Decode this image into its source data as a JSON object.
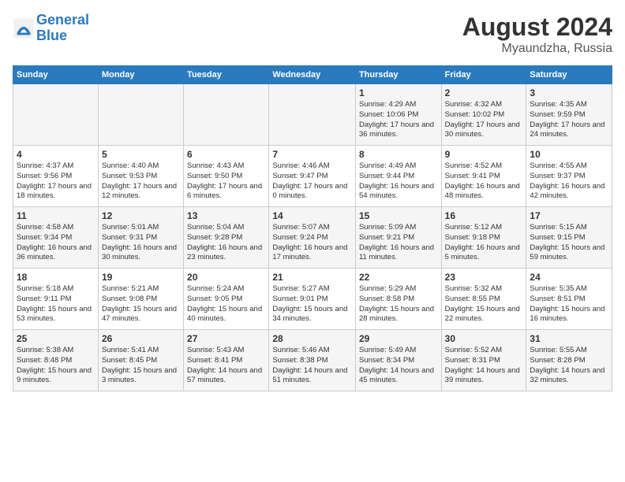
{
  "header": {
    "logo_line1": "General",
    "logo_line2": "Blue",
    "month": "August 2024",
    "location": "Myaundzha, Russia"
  },
  "days_of_week": [
    "Sunday",
    "Monday",
    "Tuesday",
    "Wednesday",
    "Thursday",
    "Friday",
    "Saturday"
  ],
  "weeks": [
    [
      {
        "num": "",
        "info": ""
      },
      {
        "num": "",
        "info": ""
      },
      {
        "num": "",
        "info": ""
      },
      {
        "num": "",
        "info": ""
      },
      {
        "num": "1",
        "info": "Sunrise: 4:29 AM\nSunset: 10:06 PM\nDaylight: 17 hours\nand 36 minutes."
      },
      {
        "num": "2",
        "info": "Sunrise: 4:32 AM\nSunset: 10:02 PM\nDaylight: 17 hours\nand 30 minutes."
      },
      {
        "num": "3",
        "info": "Sunrise: 4:35 AM\nSunset: 9:59 PM\nDaylight: 17 hours\nand 24 minutes."
      }
    ],
    [
      {
        "num": "4",
        "info": "Sunrise: 4:37 AM\nSunset: 9:56 PM\nDaylight: 17 hours\nand 18 minutes."
      },
      {
        "num": "5",
        "info": "Sunrise: 4:40 AM\nSunset: 9:53 PM\nDaylight: 17 hours\nand 12 minutes."
      },
      {
        "num": "6",
        "info": "Sunrise: 4:43 AM\nSunset: 9:50 PM\nDaylight: 17 hours\nand 6 minutes."
      },
      {
        "num": "7",
        "info": "Sunrise: 4:46 AM\nSunset: 9:47 PM\nDaylight: 17 hours\nand 0 minutes."
      },
      {
        "num": "8",
        "info": "Sunrise: 4:49 AM\nSunset: 9:44 PM\nDaylight: 16 hours\nand 54 minutes."
      },
      {
        "num": "9",
        "info": "Sunrise: 4:52 AM\nSunset: 9:41 PM\nDaylight: 16 hours\nand 48 minutes."
      },
      {
        "num": "10",
        "info": "Sunrise: 4:55 AM\nSunset: 9:37 PM\nDaylight: 16 hours\nand 42 minutes."
      }
    ],
    [
      {
        "num": "11",
        "info": "Sunrise: 4:58 AM\nSunset: 9:34 PM\nDaylight: 16 hours\nand 36 minutes."
      },
      {
        "num": "12",
        "info": "Sunrise: 5:01 AM\nSunset: 9:31 PM\nDaylight: 16 hours\nand 30 minutes."
      },
      {
        "num": "13",
        "info": "Sunrise: 5:04 AM\nSunset: 9:28 PM\nDaylight: 16 hours\nand 23 minutes."
      },
      {
        "num": "14",
        "info": "Sunrise: 5:07 AM\nSunset: 9:24 PM\nDaylight: 16 hours\nand 17 minutes."
      },
      {
        "num": "15",
        "info": "Sunrise: 5:09 AM\nSunset: 9:21 PM\nDaylight: 16 hours\nand 11 minutes."
      },
      {
        "num": "16",
        "info": "Sunrise: 5:12 AM\nSunset: 9:18 PM\nDaylight: 16 hours\nand 5 minutes."
      },
      {
        "num": "17",
        "info": "Sunrise: 5:15 AM\nSunset: 9:15 PM\nDaylight: 15 hours\nand 59 minutes."
      }
    ],
    [
      {
        "num": "18",
        "info": "Sunrise: 5:18 AM\nSunset: 9:11 PM\nDaylight: 15 hours\nand 53 minutes."
      },
      {
        "num": "19",
        "info": "Sunrise: 5:21 AM\nSunset: 9:08 PM\nDaylight: 15 hours\nand 47 minutes."
      },
      {
        "num": "20",
        "info": "Sunrise: 5:24 AM\nSunset: 9:05 PM\nDaylight: 15 hours\nand 40 minutes."
      },
      {
        "num": "21",
        "info": "Sunrise: 5:27 AM\nSunset: 9:01 PM\nDaylight: 15 hours\nand 34 minutes."
      },
      {
        "num": "22",
        "info": "Sunrise: 5:29 AM\nSunset: 8:58 PM\nDaylight: 15 hours\nand 28 minutes."
      },
      {
        "num": "23",
        "info": "Sunrise: 5:32 AM\nSunset: 8:55 PM\nDaylight: 15 hours\nand 22 minutes."
      },
      {
        "num": "24",
        "info": "Sunrise: 5:35 AM\nSunset: 8:51 PM\nDaylight: 15 hours\nand 16 minutes."
      }
    ],
    [
      {
        "num": "25",
        "info": "Sunrise: 5:38 AM\nSunset: 8:48 PM\nDaylight: 15 hours\nand 9 minutes."
      },
      {
        "num": "26",
        "info": "Sunrise: 5:41 AM\nSunset: 8:45 PM\nDaylight: 15 hours\nand 3 minutes."
      },
      {
        "num": "27",
        "info": "Sunrise: 5:43 AM\nSunset: 8:41 PM\nDaylight: 14 hours\nand 57 minutes."
      },
      {
        "num": "28",
        "info": "Sunrise: 5:46 AM\nSunset: 8:38 PM\nDaylight: 14 hours\nand 51 minutes."
      },
      {
        "num": "29",
        "info": "Sunrise: 5:49 AM\nSunset: 8:34 PM\nDaylight: 14 hours\nand 45 minutes."
      },
      {
        "num": "30",
        "info": "Sunrise: 5:52 AM\nSunset: 8:31 PM\nDaylight: 14 hours\nand 39 minutes."
      },
      {
        "num": "31",
        "info": "Sunrise: 5:55 AM\nSunset: 8:28 PM\nDaylight: 14 hours\nand 32 minutes."
      }
    ]
  ]
}
